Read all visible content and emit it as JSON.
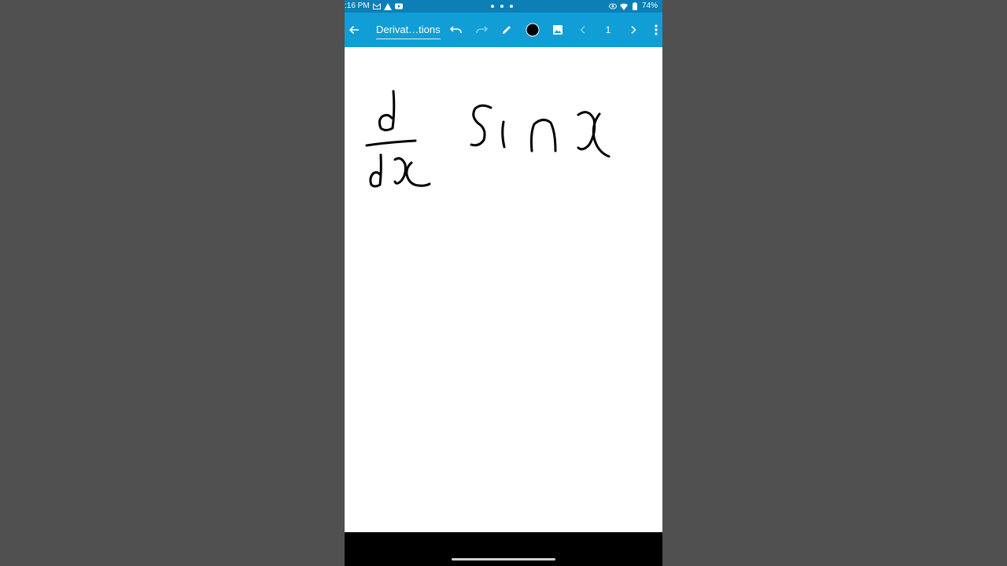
{
  "status_bar": {
    "time": ":16 PM",
    "battery": "74%",
    "icons": [
      "gmail-icon",
      "warning-icon",
      "youtube-icon",
      "eye-icon",
      "wifi-icon",
      "battery-icon"
    ]
  },
  "toolbar": {
    "title": "Derivat…tions",
    "page_number": "1",
    "pen_color": "#000000",
    "accent": "#119ed6",
    "icons": [
      "back-arrow-icon",
      "undo-icon",
      "redo-icon",
      "pencil-icon",
      "color-swatch-icon",
      "image-icon",
      "chevron-left-icon",
      "chevron-right-icon",
      "more-vert-icon"
    ]
  },
  "canvas": {
    "content": "handwritten d/dx sin x",
    "ink_color": "#000000"
  }
}
